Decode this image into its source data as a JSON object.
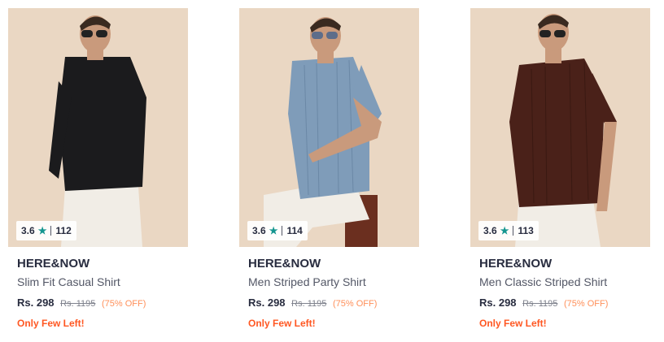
{
  "products": [
    {
      "rating": "3.6",
      "reviews": "112",
      "brand": "HERE&NOW",
      "name": "Slim Fit Casual Shirt",
      "price": "Rs. 298",
      "mrp": "Rs. 1195",
      "discount": "(75% OFF)",
      "stock": "Only Few Left!",
      "shirt_color": "#1b1b1d"
    },
    {
      "rating": "3.6",
      "reviews": "114",
      "brand": "HERE&NOW",
      "name": "Men Striped Party Shirt",
      "price": "Rs. 298",
      "mrp": "Rs. 1195",
      "discount": "(75% OFF)",
      "stock": "Only Few Left!",
      "shirt_color": "#7f9cb9"
    },
    {
      "rating": "3.6",
      "reviews": "113",
      "brand": "HERE&NOW",
      "name": "Men Classic Striped Shirt",
      "price": "Rs. 298",
      "mrp": "Rs. 1195",
      "discount": "(75% OFF)",
      "stock": "Only Few Left!",
      "shirt_color": "#4a2119"
    }
  ],
  "colors": {
    "background_image": "#ead7c3",
    "star": "#14958f",
    "discount": "#ff905a",
    "stock_alert": "#ff5722"
  },
  "icons": {
    "rating": "star-icon"
  }
}
